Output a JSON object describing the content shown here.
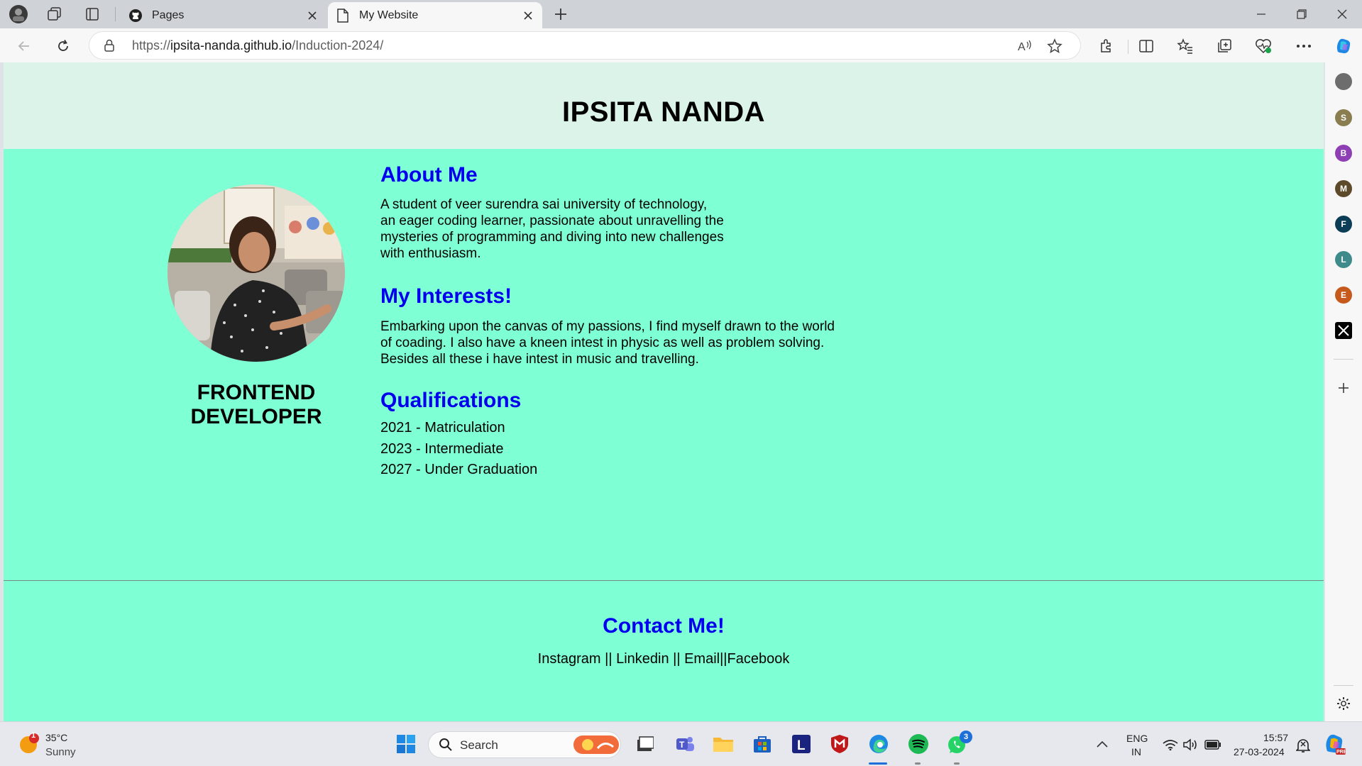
{
  "browser": {
    "tabs": [
      {
        "label": "Pages",
        "icon": "github-icon"
      },
      {
        "label": "My Website",
        "icon": "page-icon",
        "active": true
      }
    ],
    "url": {
      "scheme": "https://",
      "host": "ipsita-nanda.github.io",
      "path": "/Induction-2024/"
    },
    "sidebar_avatars": [
      "S",
      "B",
      "M",
      "F",
      "L",
      "E"
    ]
  },
  "page": {
    "title": "IPSITA NANDA",
    "role": "FRONTEND DEVELOPER",
    "about": {
      "heading": "About Me",
      "lines": [
        "A student of veer surendra sai university of technology,",
        "an eager coding learner, passionate about unravelling the",
        "mysteries of programming and diving into new challenges",
        "with enthusiasm."
      ]
    },
    "interests": {
      "heading": "My Interests!",
      "lines": [
        "Embarking upon the canvas of my passions, I find myself drawn to the world",
        "of coading. I also have a kneen intest in physic as well as problem solving.",
        "Besides all these i have intest in music and travelling."
      ]
    },
    "qualifications": {
      "heading": "Qualifications",
      "items": [
        "2021 - Matriculation",
        "2023 - Intermediate",
        "2027 - Under Graduation"
      ]
    },
    "contact": {
      "heading": "Contact Me!",
      "links": "Instagram || Linkedin || Email||Facebook"
    }
  },
  "taskbar": {
    "weather": {
      "temp": "35°C",
      "condition": "Sunny",
      "alert_count": "1"
    },
    "search_label": "Search",
    "whatsapp_badge": "3",
    "language": {
      "line1": "ENG",
      "line2": "IN"
    },
    "time": "15:57",
    "date": "27-03-2024"
  },
  "colors": {
    "page_bg": "#7fffd4",
    "header_bg": "#dcf3ea",
    "heading_blue": "#0000ee"
  }
}
